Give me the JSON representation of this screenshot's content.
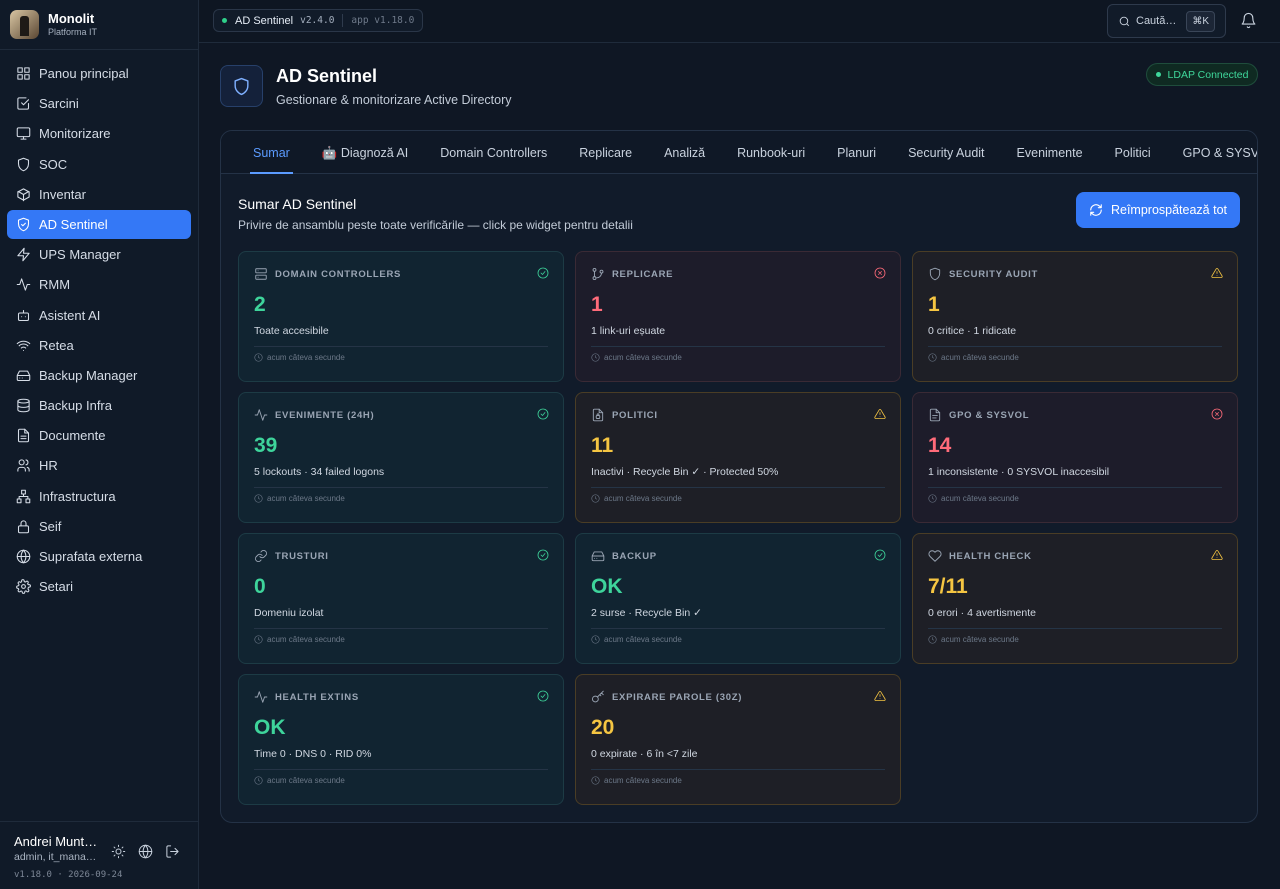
{
  "brand": {
    "name": "Monolit",
    "subtitle": "Platforma IT"
  },
  "sidebar": {
    "items": [
      {
        "label": "Panou principal",
        "icon": "grid-icon",
        "active": false
      },
      {
        "label": "Sarcini",
        "icon": "checkbox-icon",
        "active": false
      },
      {
        "label": "Monitorizare",
        "icon": "monitor-icon",
        "active": false
      },
      {
        "label": "SOC",
        "icon": "shield-icon",
        "active": false
      },
      {
        "label": "Inventar",
        "icon": "box-icon",
        "active": false
      },
      {
        "label": "AD Sentinel",
        "icon": "shield-check-icon",
        "active": true
      },
      {
        "label": "UPS Manager",
        "icon": "bolt-icon",
        "active": false
      },
      {
        "label": "RMM",
        "icon": "activity-icon",
        "active": false
      },
      {
        "label": "Asistent AI",
        "icon": "bot-icon",
        "active": false
      },
      {
        "label": "Retea",
        "icon": "wifi-icon",
        "active": false
      },
      {
        "label": "Backup Manager",
        "icon": "drive-icon",
        "active": false
      },
      {
        "label": "Backup Infra",
        "icon": "database-icon",
        "active": false
      },
      {
        "label": "Documente",
        "icon": "file-icon",
        "active": false
      },
      {
        "label": "HR",
        "icon": "users-icon",
        "active": false
      },
      {
        "label": "Infrastructura",
        "icon": "network-icon",
        "active": false
      },
      {
        "label": "Seif",
        "icon": "lock-icon",
        "active": false
      },
      {
        "label": "Suprafata externa",
        "icon": "globe-icon",
        "active": false
      },
      {
        "label": "Setari",
        "icon": "gear-icon",
        "active": false
      }
    ]
  },
  "user": {
    "name": "Andrei Munt…",
    "role": "admin, it_mana…",
    "version": "v1.18.0 · 2026-09-24"
  },
  "topbar": {
    "app_name": "AD Sentinel",
    "module_version": "v2.4.0",
    "app_version": "app v1.18.0",
    "search_placeholder": "Caută…",
    "search_shortcut": "⌘K"
  },
  "header": {
    "title": "AD Sentinel",
    "subtitle": "Gestionare & monitorizare Active Directory",
    "status_badge": "LDAP Connected"
  },
  "tabs": [
    {
      "label": "Sumar",
      "active": true
    },
    {
      "label": "🤖 Diagnoză AI",
      "active": false
    },
    {
      "label": "Domain Controllers",
      "active": false
    },
    {
      "label": "Replicare",
      "active": false
    },
    {
      "label": "Analiză",
      "active": false
    },
    {
      "label": "Runbook-uri",
      "active": false
    },
    {
      "label": "Planuri",
      "active": false
    },
    {
      "label": "Security Audit",
      "active": false
    },
    {
      "label": "Evenimente",
      "active": false
    },
    {
      "label": "Politici",
      "active": false
    },
    {
      "label": "GPO & SYSVOL",
      "active": false
    }
  ],
  "summary": {
    "title": "Sumar AD Sentinel",
    "subtitle": "Privire de ansamblu peste toate verificările — click pe widget pentru detalii",
    "refresh_label": "Reîmprospătează tot"
  },
  "colors": {
    "ok": "#3ed49b",
    "error": "#ff6b7a",
    "warning": "#f5c542",
    "accent": "#3478f6"
  },
  "cards": [
    {
      "title": "DOMAIN CONTROLLERS",
      "icon": "server-icon",
      "status": "ok",
      "value": "2",
      "desc": "Toate accesibile",
      "updated": "acum câteva secunde"
    },
    {
      "title": "REPLICARE",
      "icon": "git-branch-icon",
      "status": "err",
      "value": "1",
      "desc": "1 link-uri eșuate",
      "updated": "acum câteva secunde"
    },
    {
      "title": "SECURITY AUDIT",
      "icon": "shield-icon",
      "status": "warn",
      "value": "1",
      "desc": "0 critice · 1 ridicate",
      "updated": "acum câteva secunde"
    },
    {
      "title": "EVENIMENTE (24H)",
      "icon": "activity-icon",
      "status": "ok",
      "value": "39",
      "desc": "5 lockouts · 34 failed logons",
      "updated": "acum câteva secunde"
    },
    {
      "title": "POLITICI",
      "icon": "file-lock-icon",
      "status": "warn",
      "value": "11",
      "desc": "Inactivi · Recycle Bin ✓ · Protected 50%",
      "updated": "acum câteva secunde"
    },
    {
      "title": "GPO & SYSVOL",
      "icon": "file-text-icon",
      "status": "err",
      "value": "14",
      "desc": "1 inconsistente · 0 SYSVOL inaccesibil",
      "updated": "acum câteva secunde"
    },
    {
      "title": "TRUSTURI",
      "icon": "link-icon",
      "status": "ok",
      "value": "0",
      "desc": "Domeniu izolat",
      "updated": "acum câteva secunde"
    },
    {
      "title": "BACKUP",
      "icon": "hard-drive-icon",
      "status": "ok",
      "value": "OK",
      "desc": "2 surse · Recycle Bin ✓",
      "updated": "acum câteva secunde"
    },
    {
      "title": "HEALTH CHECK",
      "icon": "heart-icon",
      "status": "warn",
      "value": "7/11",
      "desc": "0 erori · 4 avertismente",
      "updated": "acum câteva secunde"
    },
    {
      "title": "HEALTH EXTINS",
      "icon": "activity-icon",
      "status": "ok",
      "value": "OK",
      "desc": "Time 0 · DNS 0 · RID 0%",
      "updated": "acum câteva secunde"
    },
    {
      "title": "EXPIRARE PAROLE (30Z)",
      "icon": "key-icon",
      "status": "warn",
      "value": "20",
      "desc": "0 expirate · 6 în <7 zile",
      "updated": "acum câteva secunde"
    }
  ]
}
